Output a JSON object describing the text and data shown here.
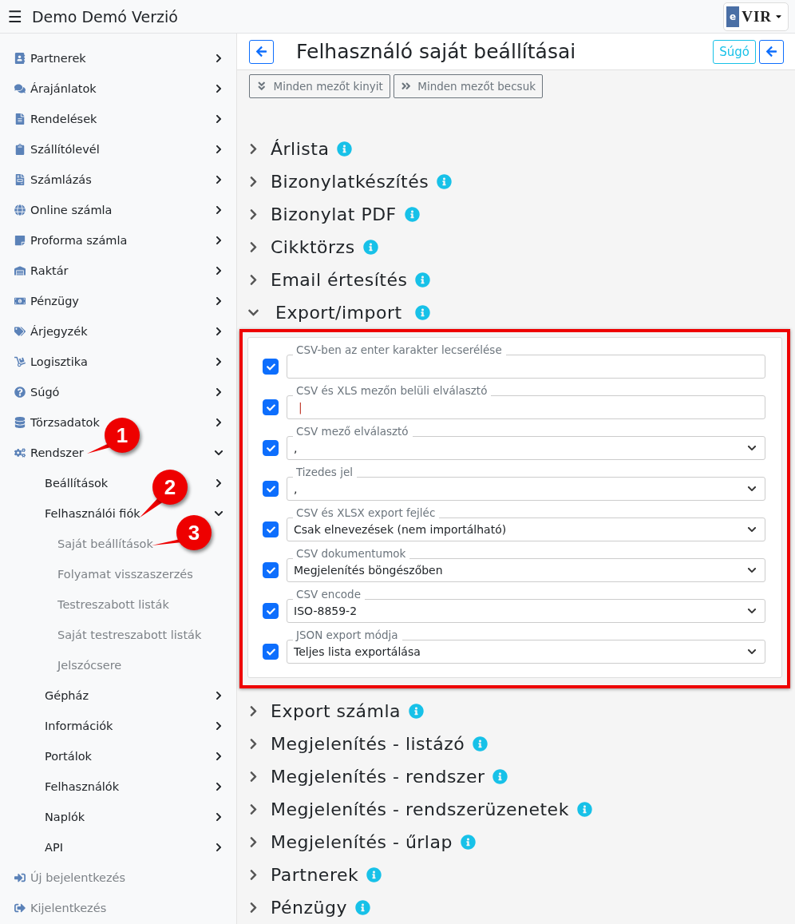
{
  "header": {
    "menu_glyph": "☰",
    "title": "Demo Demó Verzió",
    "logo": {
      "letter": "e",
      "text": "VIR"
    }
  },
  "sidebar": {
    "items": [
      {
        "label": "Partnerek",
        "kind": "main",
        "expanded": false
      },
      {
        "label": "Árajánlatok",
        "kind": "main",
        "expanded": false
      },
      {
        "label": "Rendelések",
        "kind": "main",
        "expanded": false
      },
      {
        "label": "Szállítólevél",
        "kind": "main",
        "expanded": false
      },
      {
        "label": "Számlázás",
        "kind": "main",
        "expanded": false
      },
      {
        "label": "Online számla",
        "kind": "main",
        "expanded": false
      },
      {
        "label": "Proforma számla",
        "kind": "main",
        "expanded": false
      },
      {
        "label": "Raktár",
        "kind": "main",
        "expanded": false
      },
      {
        "label": "Pénzügy",
        "kind": "main",
        "expanded": false
      },
      {
        "label": "Árjegyzék",
        "kind": "main",
        "expanded": false
      },
      {
        "label": "Logisztika",
        "kind": "main",
        "expanded": false
      },
      {
        "label": "Súgó",
        "kind": "main",
        "expanded": false
      },
      {
        "label": "Törzsadatok",
        "kind": "main",
        "expanded": false
      },
      {
        "label": "Rendszer",
        "kind": "main",
        "expanded": true,
        "children": [
          {
            "label": "Beállítások",
            "expanded": false
          },
          {
            "label": "Felhasználói fiók",
            "expanded": true,
            "children": [
              {
                "label": "Saját beállítások"
              },
              {
                "label": "Folyamat visszaszerzés"
              },
              {
                "label": "Testreszabott listák"
              },
              {
                "label": "Saját testreszabott listák"
              },
              {
                "label": "Jelszócsere"
              }
            ]
          },
          {
            "label": "Gépház",
            "expanded": false
          },
          {
            "label": "Információk",
            "expanded": false
          },
          {
            "label": "Portálok",
            "expanded": false
          },
          {
            "label": "Felhasználók",
            "expanded": false
          },
          {
            "label": "Naplók",
            "expanded": false
          },
          {
            "label": "API",
            "expanded": false
          }
        ]
      },
      {
        "label": "Új bejelentkezés",
        "kind": "action"
      },
      {
        "label": "Kijelentkezés",
        "kind": "action"
      }
    ]
  },
  "page": {
    "title": "Felhasználó saját beállításai",
    "help_button": "Súgó",
    "toolbar": [
      {
        "label": "Minden mezőt kinyit",
        "kind": "expand"
      },
      {
        "label": "Minden mezőt becsuk",
        "kind": "collapse"
      }
    ],
    "sections": [
      {
        "title": "Árlista",
        "expanded": false
      },
      {
        "title": "Bizonylatkészítés",
        "expanded": false
      },
      {
        "title": "Bizonylat PDF",
        "expanded": false
      },
      {
        "title": "Cikktörzs",
        "expanded": false
      },
      {
        "title": "Email értesítés",
        "expanded": false
      },
      {
        "title": "Export/import",
        "expanded": true,
        "highlighted": true,
        "fields": [
          {
            "label": "CSV-ben az enter karakter lecserélése",
            "kind": "text",
            "checked": true
          },
          {
            "label": "CSV és XLS mezőn belüli elválasztó",
            "kind": "text",
            "checked": true,
            "value": "|"
          },
          {
            "label": "CSV mező elválasztó",
            "kind": "select",
            "checked": true,
            "value": ","
          },
          {
            "label": "Tizedes jel",
            "kind": "select",
            "checked": true,
            "value": ","
          },
          {
            "label": "CSV és XLSX export fejléc",
            "kind": "select",
            "checked": true,
            "value": "Csak elnevezések (nem importálható)"
          },
          {
            "label": "CSV dokumentumok",
            "kind": "select",
            "checked": true,
            "value": "Megjelenítés böngészőben"
          },
          {
            "label": "CSV encode",
            "kind": "select",
            "checked": true,
            "value": "ISO-8859-2"
          },
          {
            "label": "JSON export módja",
            "kind": "select",
            "checked": true,
            "value": "Teljes lista exportálása"
          }
        ]
      },
      {
        "title": "Export számla",
        "expanded": false
      },
      {
        "title": "Megjelenítés - listázó",
        "expanded": false
      },
      {
        "title": "Megjelenítés - rendszer",
        "expanded": false
      },
      {
        "title": "Megjelenítés - rendszerüzenetek",
        "expanded": false
      },
      {
        "title": "Megjelenítés - űrlap",
        "expanded": false
      },
      {
        "title": "Partnerek",
        "expanded": false
      },
      {
        "title": "Pénzügy",
        "expanded": false
      }
    ]
  },
  "annotations": [
    {
      "label": "1"
    },
    {
      "label": "2"
    },
    {
      "label": "3"
    }
  ]
}
